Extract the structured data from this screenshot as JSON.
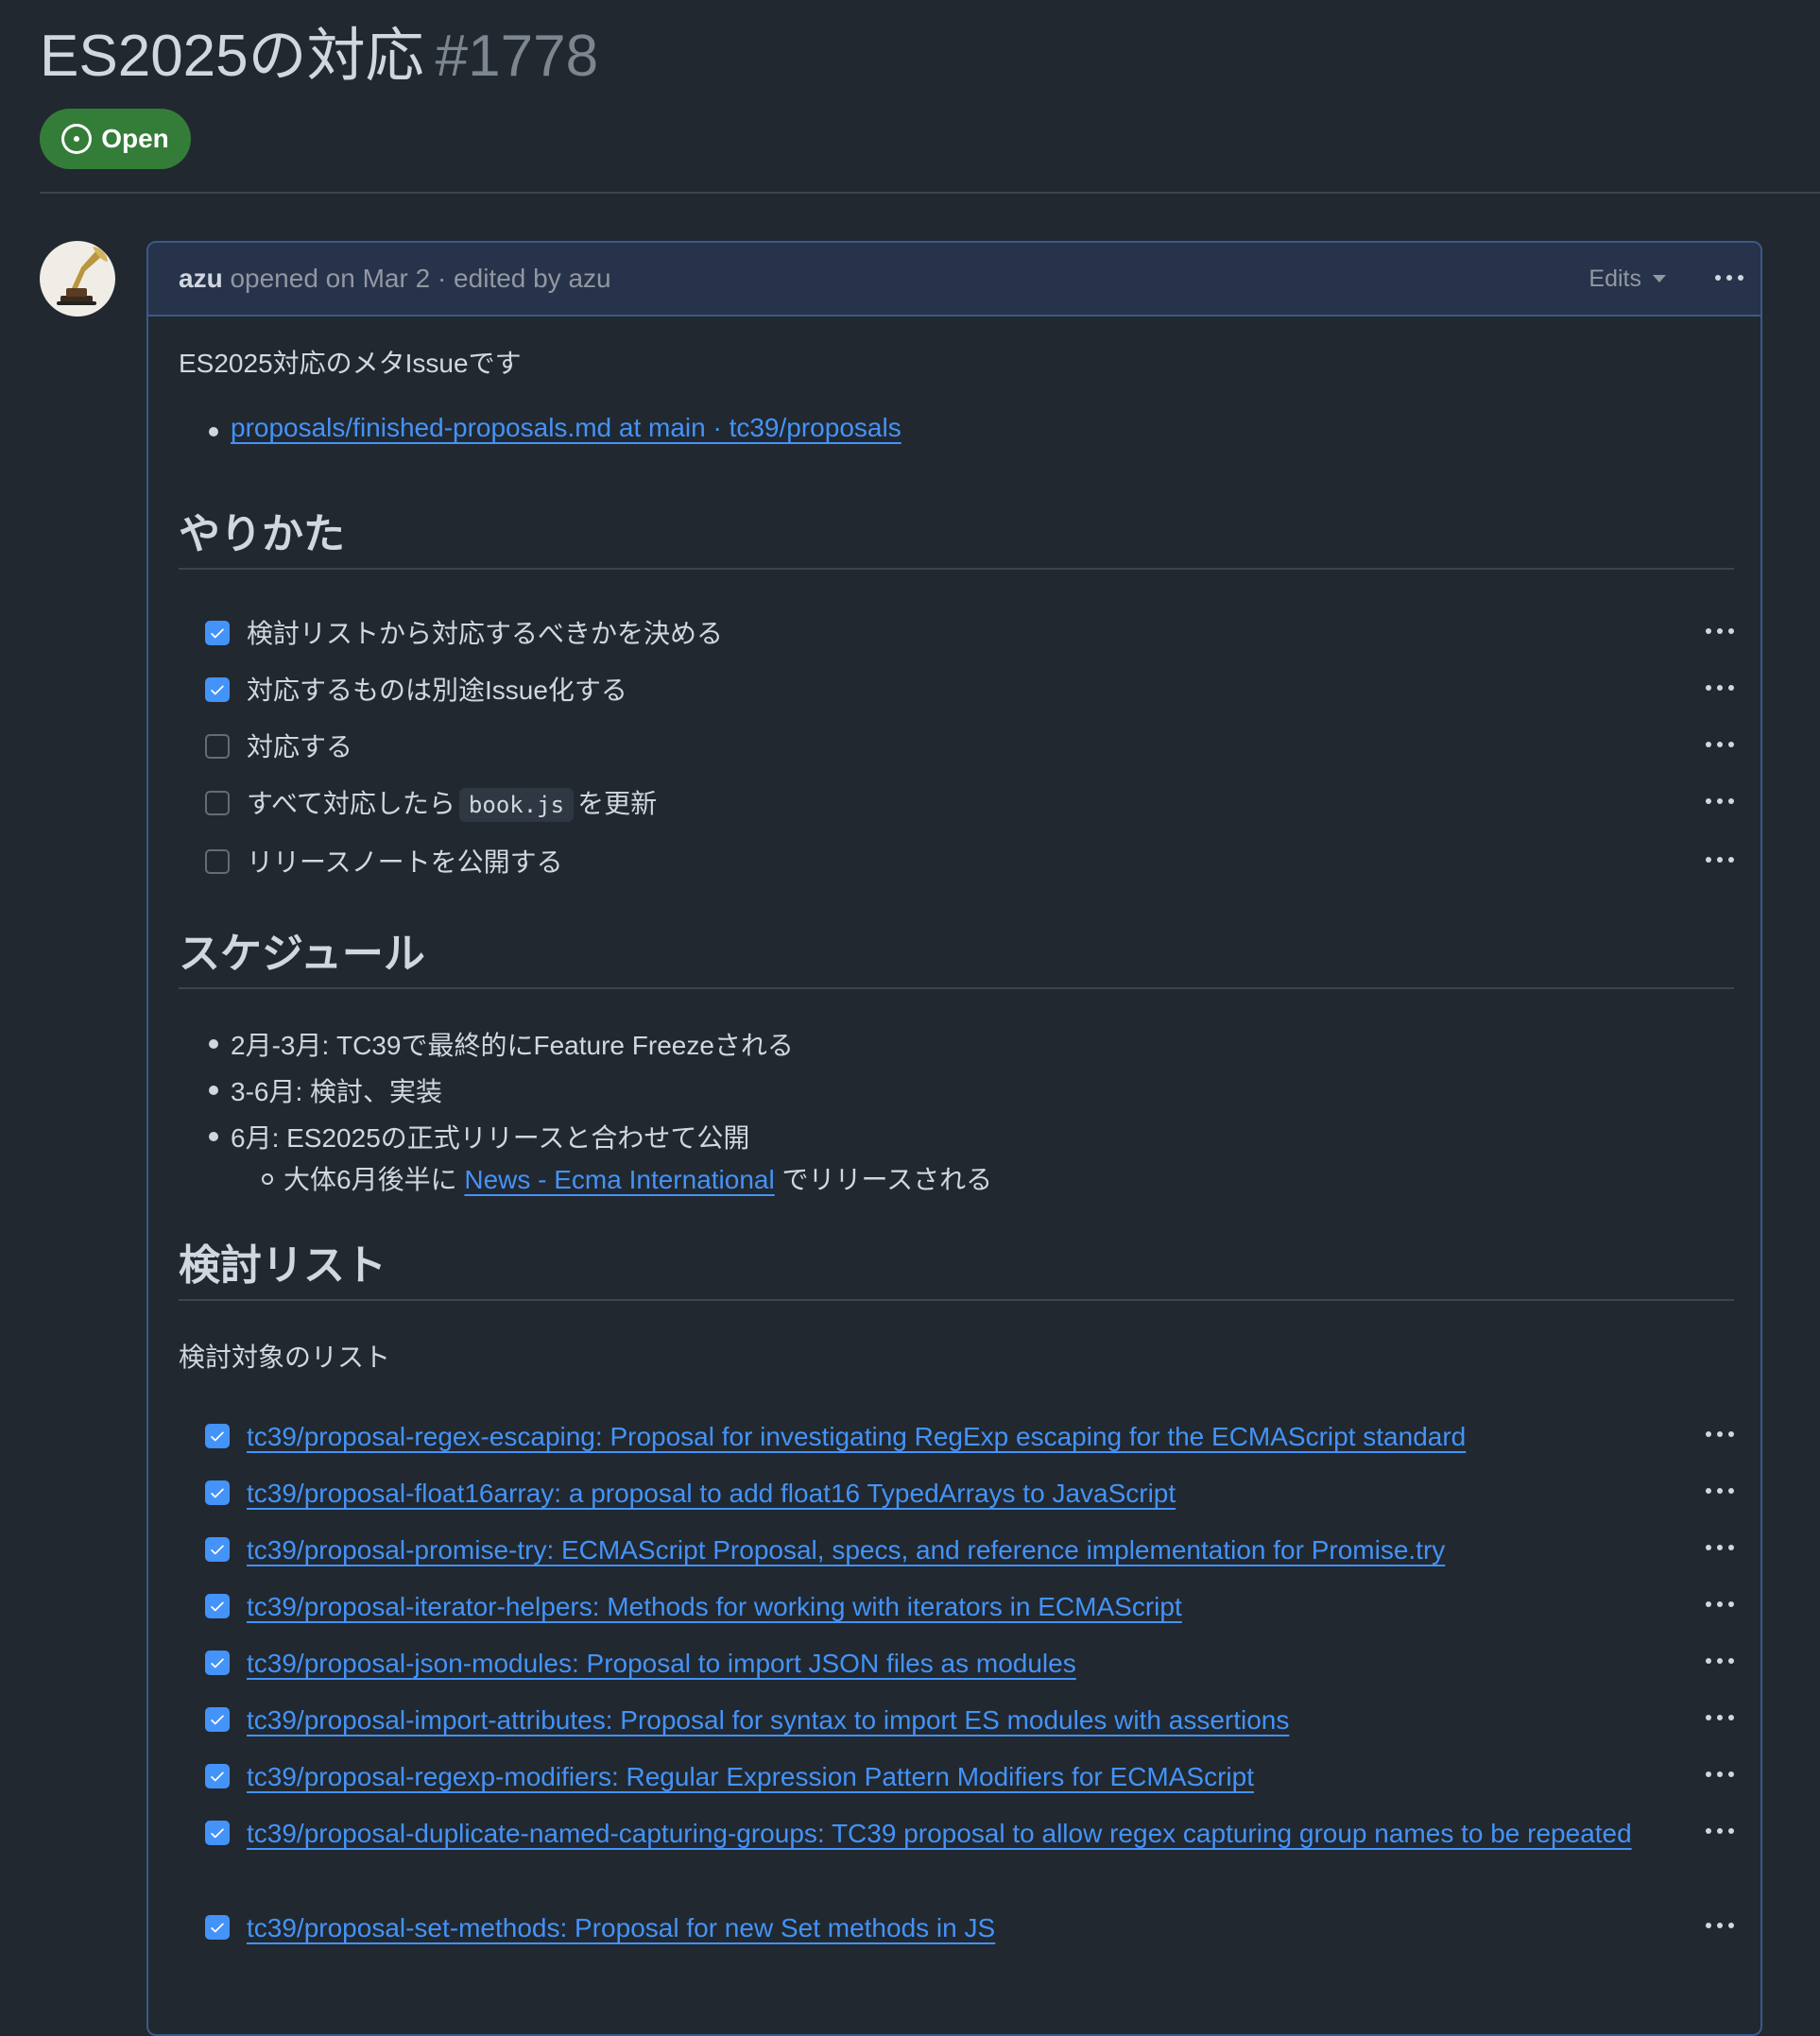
{
  "issue": {
    "title": "ES2025の対応",
    "number": "#1778",
    "state": "Open"
  },
  "comment": {
    "author": "azu",
    "meta": " opened on Mar 2 · edited by azu",
    "edits_label": "Edits",
    "intro": "ES2025対応のメタIssueです",
    "link1": "proposals/finished-proposals.md at main · tc39/proposals",
    "h_method": "やりかた",
    "tasks": [
      {
        "label": "検討リストから対応するべきかを決める",
        "checked": true
      },
      {
        "label": "対応するものは別途Issue化する",
        "checked": true
      },
      {
        "label": "対応する",
        "checked": false
      },
      {
        "label_pre": "すべて対応したら",
        "code": "book.js",
        "label_post": "を更新",
        "checked": false
      },
      {
        "label": "リリースノートを公開する",
        "checked": false
      }
    ],
    "h_schedule": "スケジュール",
    "schedule": [
      "2月-3月: TC39で最終的にFeature Freezeされる",
      "3-6月: 検討、実装",
      "6月: ES2025の正式リリースと合わせて公開"
    ],
    "schedule_sub_pre": "大体6月後半に",
    "schedule_sub_link": "News - Ecma International",
    "schedule_sub_post": "でリリースされる",
    "h_review": "検討リスト",
    "review_intro": "検討対象のリスト",
    "review_items": [
      "tc39/proposal-regex-escaping: Proposal for investigating RegExp escaping for the ECMAScript standard",
      "tc39/proposal-float16array: a proposal to add float16 TypedArrays to JavaScript",
      "tc39/proposal-promise-try: ECMAScript Proposal, specs, and reference implementation for Promise.try",
      "tc39/proposal-iterator-helpers: Methods for working with iterators in ECMAScript",
      "tc39/proposal-json-modules: Proposal to import JSON files as modules",
      "tc39/proposal-import-attributes: Proposal for syntax to import ES modules with assertions",
      "tc39/proposal-regexp-modifiers: Regular Expression Pattern Modifiers for ECMAScript",
      "tc39/proposal-duplicate-named-capturing-groups: TC39 proposal to allow regex capturing group names to be repeated",
      "tc39/proposal-set-methods: Proposal for new Set methods in JS"
    ],
    "review_checked": [
      true,
      true,
      true,
      true,
      true,
      true,
      true,
      true,
      true
    ]
  },
  "colors": {
    "background": "#212830",
    "open_badge": "#347d39",
    "link": "#4493f8",
    "checkbox_checked": "#4493f8"
  },
  "icons": {
    "state": "issue-opened-icon",
    "avatar": "gramophone-avatar",
    "more": "kebab-horizontal-icon"
  }
}
